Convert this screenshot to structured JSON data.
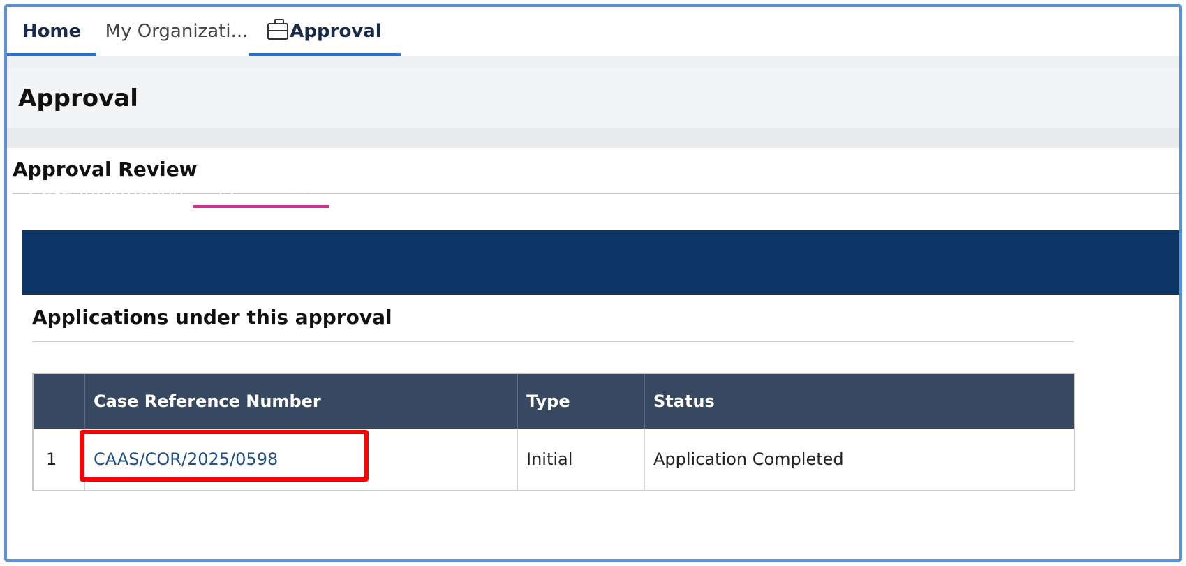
{
  "top_tabs": {
    "home": "Home",
    "organization": "My Organizati...",
    "approval": "Approval"
  },
  "icons": {
    "approval_tab_icon": "briefcase-icon"
  },
  "header": {
    "title": "Approval"
  },
  "review": {
    "title": "Approval Review"
  },
  "inner_tabs": {
    "case_information": "Case Information",
    "applications": "Applications"
  },
  "applications": {
    "heading": "Applications under this approval",
    "columns": {
      "case_reference_number": "Case Reference Number",
      "type": "Type",
      "status": "Status"
    },
    "rows": [
      {
        "index": "1",
        "case_reference_number": "CAAS/COR/2025/0598",
        "type": "Initial",
        "status": "Application Completed"
      }
    ]
  },
  "colors": {
    "nav_bar": "#0c3566",
    "table_header": "#374960",
    "active_tab_underline": "#2d6fd0",
    "applications_tab_underline": "#d0338f",
    "highlight": "#ff0000"
  }
}
